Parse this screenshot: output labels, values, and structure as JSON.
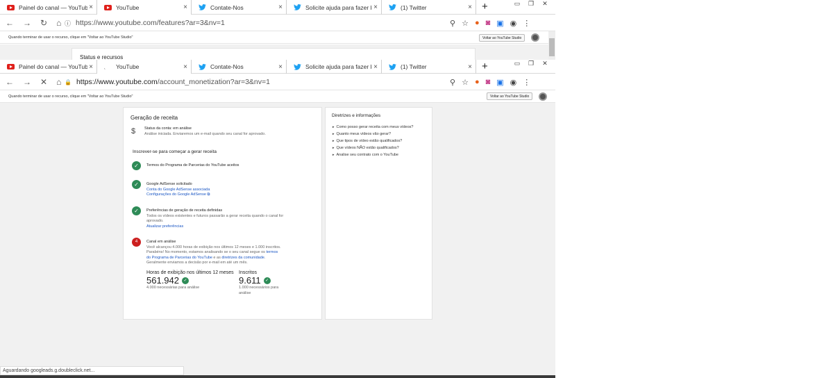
{
  "back_window": {
    "tabs": [
      {
        "label": "Painel do canal — YouTube S",
        "icon": "youtube-icon"
      },
      {
        "label": "YouTube",
        "icon": "youtube-icon"
      },
      {
        "label": "Contate-Nos",
        "icon": "twitter-icon"
      },
      {
        "label": "Solicite ajuda para fazer logi",
        "icon": "twitter-icon"
      },
      {
        "label": "(1) Twitter",
        "icon": "twitter-icon"
      }
    ],
    "url": "https://www.youtube.com/features?ar=3&nv=1",
    "info": "Quando terminar de usar o recurso, clique em \"Voltar ao YouTube Studio\"",
    "info_button": "Voltar ao YouTube Studio",
    "peek_title": "Status e recursos"
  },
  "front_window": {
    "tabs": [
      {
        "label": "Painel do canal — YouTube S",
        "icon": "youtube-icon"
      },
      {
        "label": "YouTube",
        "icon": "loading-icon"
      },
      {
        "label": "Contate-Nos",
        "icon": "twitter-icon"
      },
      {
        "label": "Solicite ajuda para fazer logi",
        "icon": "twitter-icon"
      },
      {
        "label": "(1) Twitter",
        "icon": "twitter-icon"
      }
    ],
    "url_host": "https://www.youtube.com",
    "url_path": "/account_monetization?ar=3&nv=1",
    "info": "Quando terminar de usar o recurso, clique em \"Voltar ao YouTube Studio\"",
    "info_button": "Voltar ao YouTube Studio"
  },
  "monetization": {
    "title": "Geração de receita",
    "status_title": "Status da conta: em análise",
    "status_sub": "Análise iniciada. Enviaremos um e-mail quando seu canal for aprovado.",
    "signup_heading": "Inscrever-se para começar a gerar receita",
    "step1": "Termos do Programa de Parcerias do YouTube aceitos",
    "step2_title": "Google AdSense solicitado",
    "step2_link1": "Conta do Google AdSense associada",
    "step2_link2": "Configurações do Google AdSense",
    "step3_title": "Preferências de geração de receita definidas",
    "step3_sub": "Todos os vídeos existentes e futuros passarão a gerar receita quando o canal for aprovado.",
    "step3_link": "Atualizar preferências",
    "step4_num": "4",
    "step4_title": "Canal em análise",
    "step4_sub_a": "Você alcançou 4.000 horas de exibição nos últimos 12 meses e 1.000 inscritos. Parabéns! No momento, estamos analisando se o seu canal segue os",
    "step4_link1": "termos do Programa de Parcerias do YouTube",
    "step4_sub_b": "e as",
    "step4_link2": "diretrizes da comunidade",
    "step4_sub_c": ". Geralmente enviamos a decisão por e-mail em até um mês.",
    "hours_label": "Horas de exibição nos últimos 12 meses",
    "hours_value": "561.942",
    "hours_req": "4.000 necessárias para análise",
    "subs_label": "Inscritos",
    "subs_value": "9.611",
    "subs_req": "1.000 necessários para análise"
  },
  "guidelines": {
    "title": "Diretrizes e informações",
    "items": [
      "Como posso gerar receita com meus vídeos?",
      "Quanto meus vídeos vão gerar?",
      "Que tipos de vídeo estão qualificados?",
      "Que vídeos NÃO estão qualificados?",
      "Analise seu contrato com o YouTube"
    ]
  },
  "status_bar": "Aguardando googleads.g.doubleclick.net..."
}
